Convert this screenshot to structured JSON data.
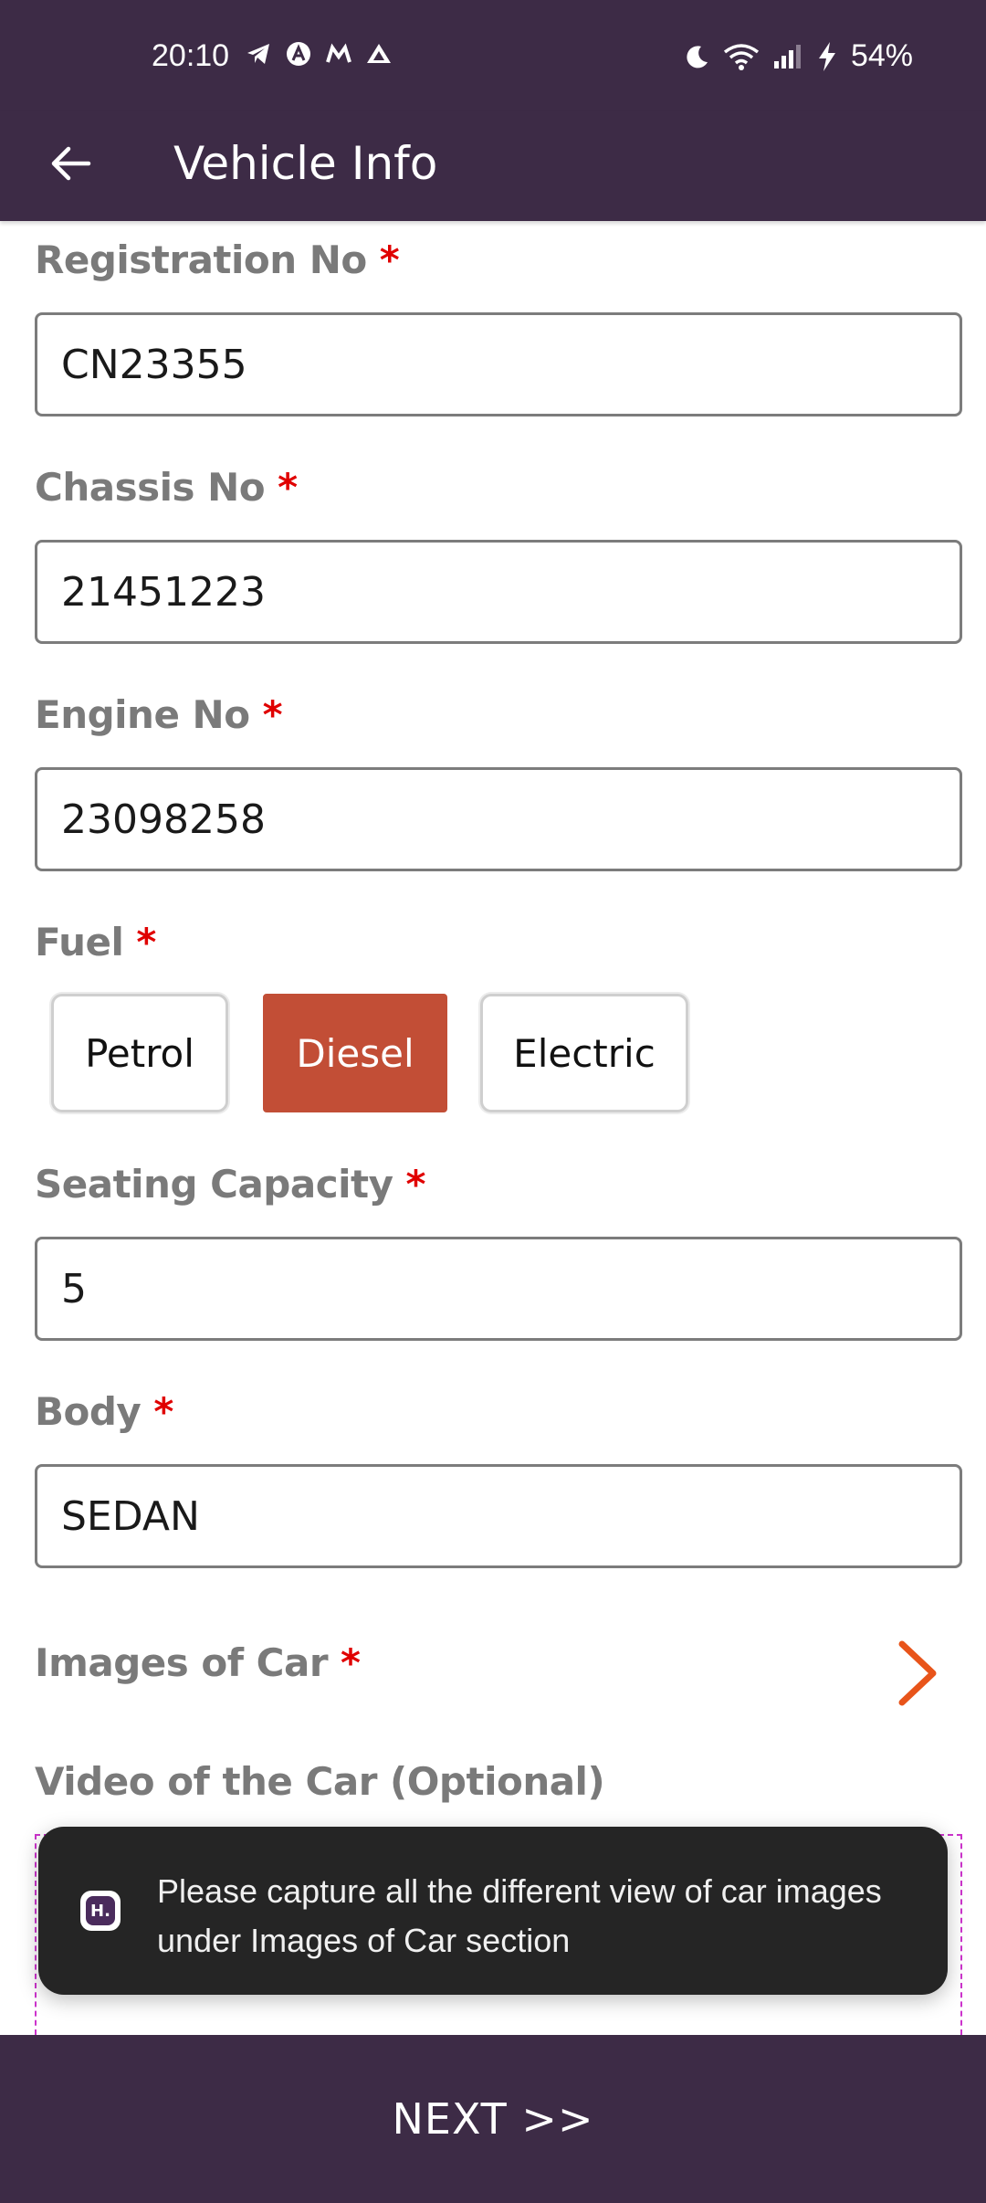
{
  "status_bar": {
    "time": "20:10",
    "left_icons": [
      "telegram-icon",
      "app-a-icon",
      "app-m-icon",
      "drive-icon"
    ],
    "battery": "54%",
    "right_icons": [
      "moon-icon",
      "wifi-icon",
      "signal-icon",
      "charging-icon"
    ]
  },
  "app_bar": {
    "title": "Vehicle Info",
    "back_icon": "arrow-left-icon"
  },
  "form": {
    "registration": {
      "label": "Registration No",
      "required": "*",
      "value": "CN23355"
    },
    "chassis": {
      "label": "Chassis No",
      "required": "*",
      "value": "21451223"
    },
    "engine": {
      "label": "Engine No",
      "required": "*",
      "value": "23098258"
    },
    "fuel": {
      "label": "Fuel",
      "required": "*",
      "options": [
        "Petrol",
        "Diesel",
        "Electric"
      ],
      "selected": "Diesel"
    },
    "seating": {
      "label": "Seating Capacity",
      "required": "*",
      "value": "5"
    },
    "body": {
      "label": "Body",
      "required": "*",
      "value": "SEDAN"
    },
    "images": {
      "label": "Images of Car",
      "required": "*",
      "chevron_icon": "chevron-right-icon"
    },
    "video": {
      "label": "Video of the Car (Optional)"
    }
  },
  "toast": {
    "message": "Please capture all the different view of car images under Images of Car section",
    "icon": "app-logo-icon",
    "icon_text": "H."
  },
  "footer": {
    "next_label": "NEXT >>"
  },
  "colors": {
    "primary": "#3d2b46",
    "selected_fuel": "#c24e36",
    "chevron": "#e8541a",
    "required": "#e00000",
    "video_border": "#cc33cc"
  }
}
